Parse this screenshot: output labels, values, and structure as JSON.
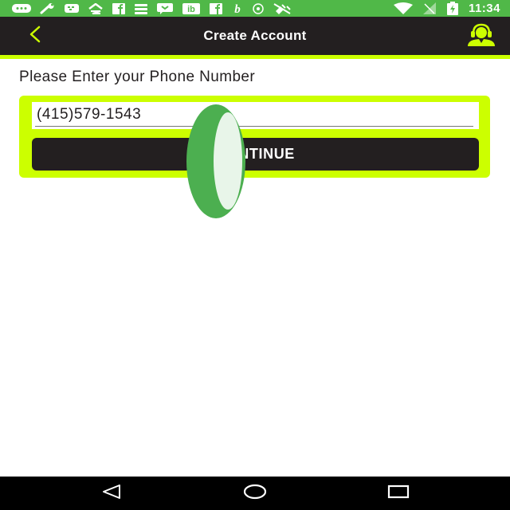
{
  "status_bar": {
    "time": "11:34",
    "icons": [
      "messenger-icon",
      "wrench-icon",
      "bbm-icon",
      "zillow-icon",
      "facebook-icon",
      "stack-icon",
      "chat-icon",
      "ib-icon",
      "facebook-icon",
      "b-icon",
      "record-icon",
      "no-satellite-icon",
      "wifi-icon",
      "no-signal-icon",
      "battery-charging-icon"
    ],
    "color": "#50b848"
  },
  "header": {
    "title": "Create Account",
    "back_icon": "chevron-left-icon",
    "support_icon": "support-agent-icon",
    "background": "#231f20",
    "accent": "#ccff00"
  },
  "form": {
    "prompt": "Please Enter your Phone Number",
    "phone_value": "(415)579-1543",
    "continue_label": "CONTINUE"
  },
  "nav_bar": {
    "back_icon": "nav-back-icon",
    "home_icon": "nav-home-icon",
    "recents_icon": "nav-recents-icon"
  }
}
